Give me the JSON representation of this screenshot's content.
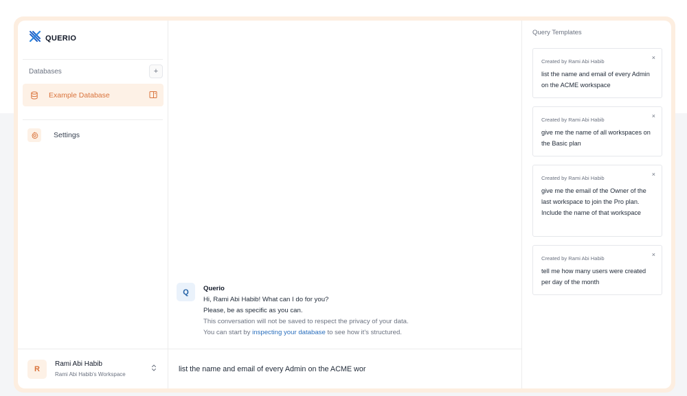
{
  "brand": {
    "name": "QUERIO"
  },
  "sidebar": {
    "databases_label": "Databases",
    "add_icon": "plus-icon",
    "databases": [
      {
        "label": "Example Database",
        "icon": "database-icon",
        "active": true
      }
    ],
    "settings_label": "Settings",
    "user": {
      "initial": "R",
      "name": "Rami Abi Habib",
      "workspace": "Rami Abi Habib's Workspace"
    }
  },
  "chat": {
    "sender_initial": "Q",
    "sender": "Querio",
    "greeting": "Hi, Rami Abi Habib! What can I do for you?",
    "instruction": "Please, be as specific as you can.",
    "privacy_note": "This conversation will not be saved to respect the privacy of your data.",
    "hint_prefix": "You can start by",
    "hint_link": "inspecting your database",
    "hint_suffix": "to see how it's structured.",
    "input_value": "list the name and email of every Admin on the ACME wor"
  },
  "templates": {
    "title": "Query Templates",
    "items": [
      {
        "created_by": "Created by Rami Abi Habib",
        "text": "list the name and email of every Admin on the ACME workspace"
      },
      {
        "created_by": "Created by Rami Abi Habib",
        "text": "give me the name of all workspaces on the Basic plan"
      },
      {
        "created_by": "Created by Rami Abi Habib",
        "text": "give me the email of the Owner of the last workspace to join the Pro plan. Include the name of that workspace"
      },
      {
        "created_by": "Created by Rami Abi Habib",
        "text": "tell me how many users were created per day of the month"
      }
    ],
    "close_glyph": "×"
  },
  "colors": {
    "accent": "#d9723a",
    "accent_bg": "#fdf1e6",
    "link": "#2a6fbd",
    "brand_blue": "#1e63c8"
  }
}
